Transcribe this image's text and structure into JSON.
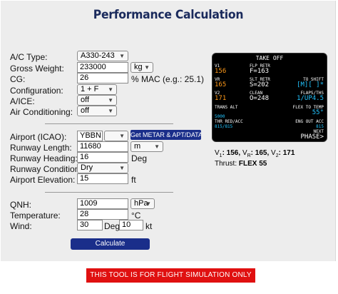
{
  "title": "Performance Calculation",
  "aircraft": {
    "type_label": "A/C Type:",
    "type_value": "A330-243",
    "gross_weight_label": "Gross Weight:",
    "gross_weight_value": "233000",
    "gross_weight_unit": "kg",
    "cg_label": "CG:",
    "cg_value": "26",
    "cg_unit": "% MAC (e.g.: 25.1)",
    "config_label": "Configuration:",
    "config_value": "1 + F",
    "aice_label": "A/ICE:",
    "aice_value": "off",
    "aircon_label": "Air Conditioning:",
    "aircon_value": "off"
  },
  "airport": {
    "icao_label": "Airport (ICAO):",
    "icao_value": "YBBN",
    "icao_select_value": "",
    "metar_button": "Get METAR & APT/DATA",
    "rwy_length_label": "Runway Length:",
    "rwy_length_value": "11680",
    "rwy_length_unit": "m",
    "rwy_heading_label": "Runway Heading:",
    "rwy_heading_value": "16",
    "rwy_heading_unit": "Deg",
    "rwy_condition_label": "Runway Condition:",
    "rwy_condition_value": "Dry",
    "elevation_label": "Airport Elevation:",
    "elevation_value": "15",
    "elevation_unit": "ft"
  },
  "weather": {
    "qnh_label": "QNH:",
    "qnh_value": "1009",
    "qnh_unit": "hPa",
    "temp_label": "Temperature:",
    "temp_value": "28",
    "temp_unit": "°C",
    "wind_label": "Wind:",
    "wind_dir_value": "30",
    "wind_dir_unit": "Deg",
    "wind_speed_value": "10",
    "wind_speed_unit": "kt"
  },
  "calculate_button": "Calculate",
  "warning": "THIS TOOL IS FOR FLIGHT SIMULATION ONLY",
  "mcdu": {
    "header": "TAKE OFF",
    "v1_label": "V1",
    "v1_value": "156",
    "flp_retr_label": "FLP RETR",
    "flp_retr_value": "F=163",
    "vr_label": "VR",
    "vr_value": "165",
    "slt_retr_label": "SLT RETR",
    "slt_retr_value": "S=202",
    "to_shift_label": "TO SHIFT",
    "to_shift_value": "[M][  ]*",
    "v2_label": "V2",
    "v2_value": "171",
    "clean_label": "CLEAN",
    "clean_value": "O=248",
    "flaps_ths_label": "FLAPS/THS",
    "flaps_ths_value": "1/UP4.5",
    "trans_alt_label": "TRANS ALT",
    "trans_alt_value": "5000",
    "flex_label": "FLEX TO TEMP",
    "flex_value": "55°",
    "thr_red_label": "THR RED/ACC",
    "thr_red_value": "815/815",
    "eng_out_label": "ENG OUT ACC",
    "eng_out_value": "815",
    "next_label": "NEXT",
    "next_value": "PHASE>"
  },
  "results": {
    "v1_label": "V",
    "v1_sub": "1",
    "v1_value": ": 156,",
    "vr_label": "V",
    "vr_sub": "R",
    "vr_value": ": 165,",
    "v2_label": "V",
    "v2_sub": "2",
    "v2_value": ": 171",
    "thrust_label": "Thrust:",
    "thrust_value": "FLEX 55"
  },
  "colors": {
    "accent": "#1a2e8a",
    "title": "#1a2a5c",
    "warning": "#e01010",
    "mcdu_green": "#3bdc3b",
    "mcdu_orange": "#ff9a1a",
    "mcdu_cyan": "#22c4ff"
  }
}
